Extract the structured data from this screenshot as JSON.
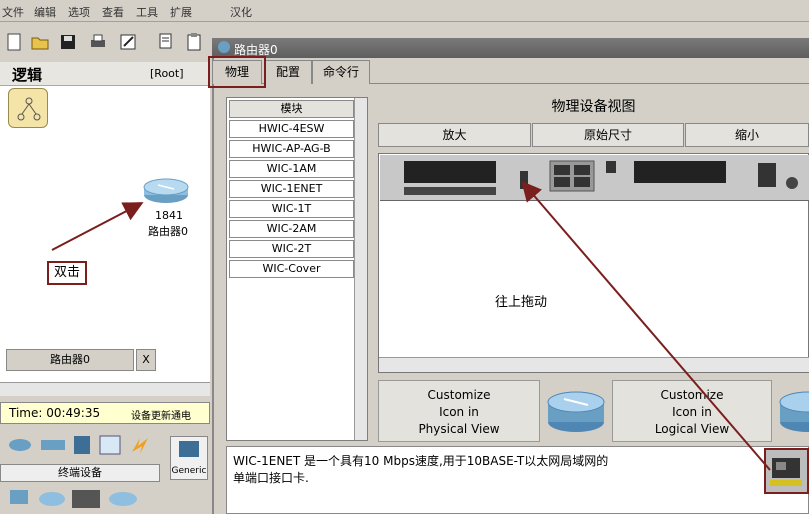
{
  "menu": [
    "文件",
    "编辑",
    "选项",
    "查看",
    "工具",
    "扩展",
    "汉化"
  ],
  "workspace": {
    "title": "逻辑",
    "root_label": "[Root]",
    "router_model": "1841",
    "router_name": "路由器0",
    "annotation": "双击",
    "tab_label": "路由器0",
    "tab_close": "X"
  },
  "timebar": {
    "time": "Time: 00:49:35",
    "action": "设备更新通电"
  },
  "device_panel": {
    "category": "终端设备",
    "generic": "Generic"
  },
  "dialog": {
    "title": "路由器0",
    "tabs": [
      "物理",
      "配置",
      "命令行"
    ],
    "module_header": "模块",
    "modules": [
      "HWIC-4ESW",
      "HWIC-AP-AG-B",
      "WIC-1AM",
      "WIC-1ENET",
      "WIC-1T",
      "WIC-2AM",
      "WIC-2T",
      "WIC-Cover"
    ],
    "view_title": "物理设备视图",
    "view_buttons": [
      "放大",
      "原始尺寸",
      "缩小"
    ],
    "drag_hint": "往上拖动",
    "customize_physical": [
      "Customize",
      "Icon in",
      "Physical View"
    ],
    "customize_logical": [
      "Customize",
      "Icon in",
      "Logical View"
    ],
    "description_line1": "WIC-1ENET 是一个具有10 Mbps速度,用于10BASE-T以太网局域网的",
    "description_line2": "单端口接口卡."
  },
  "colors": {
    "annotation_border": "#7a1e1e",
    "arrow": "#7a1e1e"
  }
}
